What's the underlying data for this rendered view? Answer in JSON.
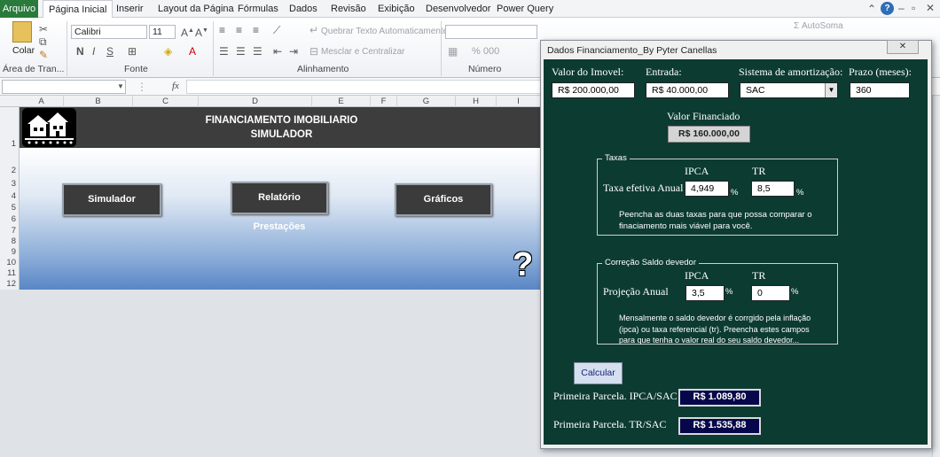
{
  "ribbon": {
    "file_tab": "Arquivo",
    "tabs": [
      "Página Inicial",
      "Inserir",
      "Layout da Página",
      "Fórmulas",
      "Dados",
      "Revisão",
      "Exibição",
      "Desenvolvedor",
      "Power Query"
    ],
    "paste_label": "Colar",
    "font_name": "Calibri",
    "font_size": "11",
    "wrap_text": "Quebrar Texto Automaticamente",
    "merge_center": "Mesclar e Centralizar",
    "autosum": "AutoSoma",
    "number_format_symbols": "% 000",
    "groups": {
      "clipboard": "Área de Tran...",
      "font": "Fonte",
      "alignment": "Alinhamento",
      "number": "Número"
    }
  },
  "formula_bar": {
    "fx": "fx",
    "name_box": ""
  },
  "sheet": {
    "columns": [
      "A",
      "B",
      "C",
      "D",
      "E",
      "F",
      "G",
      "H",
      "I"
    ],
    "rows": [
      "1",
      "2",
      "3",
      "4",
      "5",
      "6",
      "7",
      "8",
      "9",
      "10",
      "11",
      "12"
    ],
    "title_line1": "FINANCIAMENTO IMOBILIARIO",
    "title_line2": "SIMULADOR",
    "buttons": {
      "simulador": "Simulador",
      "relatorio": "Relatório Prestações",
      "graficos": "Gráficos"
    },
    "help_glyph": "?"
  },
  "dialog": {
    "title": "Dados Financiamento_By Pyter Canellas",
    "labels": {
      "valor_imovel": "Valor do Imovel:",
      "entrada": "Entrada:",
      "sistema": "Sistema de amortização:",
      "prazo": "Prazo (meses):"
    },
    "values": {
      "valor_imovel": "R$ 200.000,00",
      "entrada": "R$ 40.000,00",
      "sistema": "SAC",
      "prazo": "360"
    },
    "valor_financiado_label": "Valor Financiado",
    "valor_financiado": "R$ 160.000,00",
    "taxas": {
      "frame_label": "Taxas",
      "col_ipca": "IPCA",
      "col_tr": "TR",
      "row_label": "Taxa efetiva Anual",
      "ipca_value": "4,949",
      "tr_value": "8,5",
      "pct": "%",
      "note": "Peencha as duas taxas para que possa comparar o finaciamento mais viável para você."
    },
    "correcao": {
      "frame_label": "Correção Saldo devedor",
      "col_ipca": "IPCA",
      "col_tr": "TR",
      "row_label": "Projeção Anual",
      "ipca_value": "3,5",
      "tr_value": "0",
      "pct": "%",
      "note": "Mensalmente o saldo devedor é corrgido pela inflação (ipca) ou taxa referencial (tr). Preencha estes campos para que tenha o valor real do seu saldo devedor..."
    },
    "calcular": "Calcular",
    "results": {
      "ipca_label": "Primeira Parcela. IPCA/SAC",
      "ipca_value": "R$ 1.089,80",
      "tr_label": "Primeira Parcela. TR/SAC",
      "tr_value": "R$ 1.535,88"
    }
  }
}
